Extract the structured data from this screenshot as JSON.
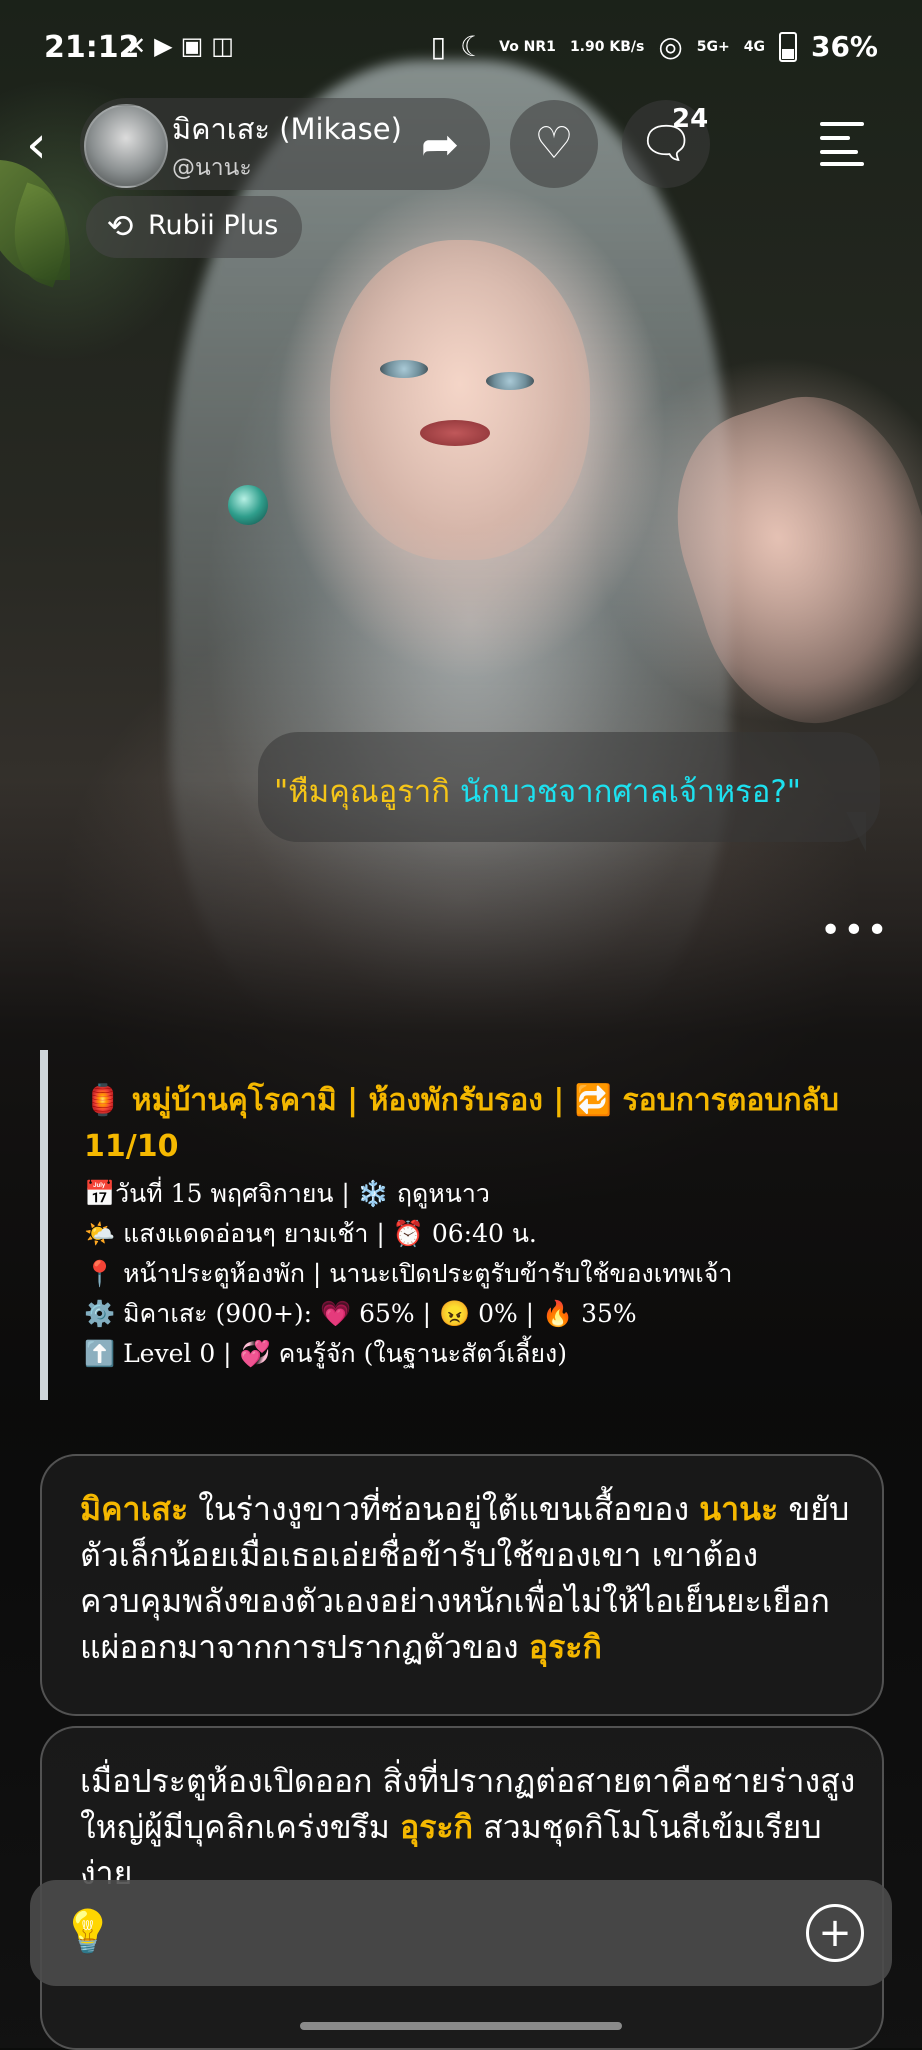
{
  "status_bar": {
    "time": "21:12",
    "left_icons": "✕▶▣◫",
    "network": "Vo NR1",
    "speed": "1.90 KB/s",
    "signal": "5G+",
    "signal2": "4G",
    "battery": "36%"
  },
  "header": {
    "character_name": "มิคาเสะ (Mikase)",
    "handle": "@นานะ",
    "comment_count": "24",
    "rubii_label": "Rubii Plus"
  },
  "bubble": {
    "part1": "\"หืมคุณอูรากิ ",
    "part2": "นักบวชจากศาลเจ้าหรอ?\""
  },
  "more": "•••",
  "status_block": {
    "title_line": "🏮 หมู่บ้านคุโรคามิ | ห้องพักรับรอง | 🔁 รอบการตอบกลับ 11/10",
    "date_line": "📅วันที่ 15 พฤศจิกายน | ❄️ ฤดูหนาว",
    "time_line": "🌤️ แสงแดดอ่อนๆ ยามเช้า | ⏰ 06:40 น.",
    "location_line": "📍 หน้าประตูห้องพัก | นานะเปิดประตูรับข้ารับใช้ของเทพเจ้า",
    "stats_line": "⚙️ มิคาเสะ (900+): 💗 65% | 😠 0% | 🔥 35%",
    "level_line": "⬆️ Level 0 | 💞 คนรู้จัก (ในฐานะสัตว์เลี้ยง)"
  },
  "card1": {
    "name1": "มิคาเสะ",
    "text1": " ในร่างงูขาวที่ซ่อนอยู่ใต้แขนเสื้อของ ",
    "name2": "นานะ",
    "text2": " ขยับตัวเล็กน้อยเมื่อเธอเอ่ยชื่อข้ารับใช้ของเขา เขาต้องควบคุมพลังของตัวเองอย่างหนักเพื่อไม่ให้ไอเย็นยะเยือกแผ่ออกมาจากการปรากฏตัวของ ",
    "name3": "อุระกิ"
  },
  "card2": {
    "text1": "เมื่อประตูห้องเปิดออก สิ่งที่ปรากฏต่อสายตาคือชายร่างสูงใหญ่ผู้มีบุคลิกเคร่งขรึม ",
    "name1": "อุระกิ",
    "text2": " สวมชุดกิโมโนสีเข้มเรียบง่าย"
  },
  "input_bar": {
    "placeholder": ""
  },
  "icons": {
    "back": "back-chevron-icon",
    "share": "share-arrow-icon",
    "heart": "heart-icon",
    "comment": "comment-bubble-icon",
    "menu": "list-menu-icon",
    "rubii": "rubii-refresh-icon",
    "bulb": "lightbulb-icon",
    "plus": "plus-circle-icon"
  },
  "colors": {
    "highlight": "#f5b800",
    "cyan": "#1de1ef",
    "yellow": "#f5c518"
  }
}
